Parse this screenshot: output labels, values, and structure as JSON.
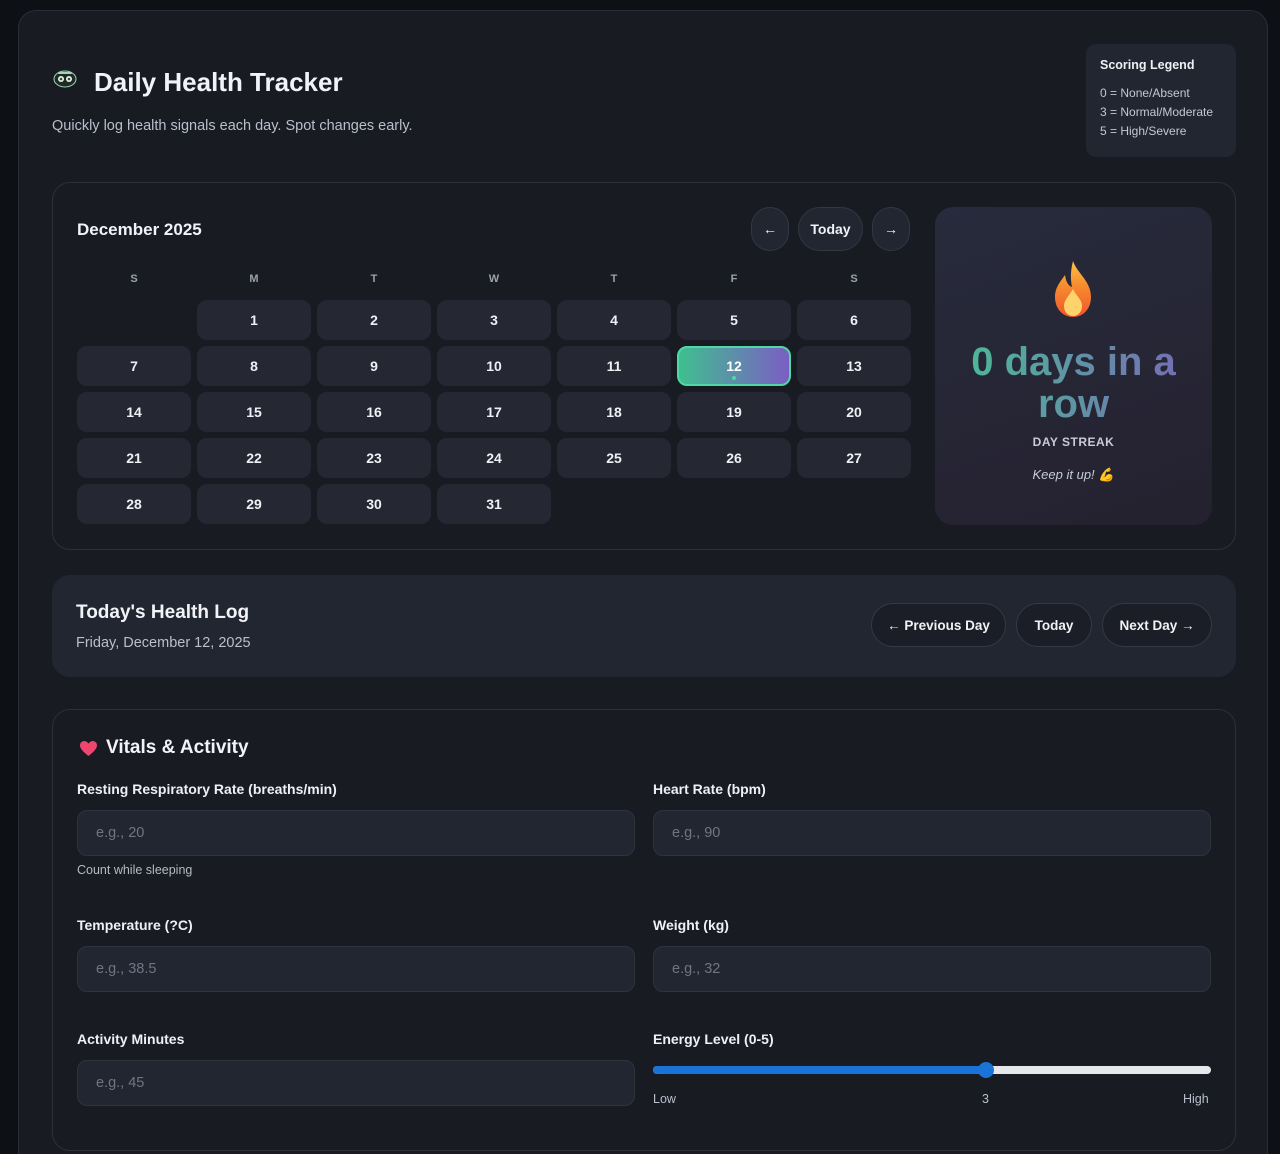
{
  "header": {
    "title": "Daily Health Tracker",
    "subtitle": "Quickly log health signals each day. Spot changes early."
  },
  "legend": {
    "title": "Scoring Legend",
    "rows": [
      "0 = None/Absent",
      "3 = Normal/Moderate",
      "5 = High/Severe"
    ]
  },
  "calendar": {
    "month_label": "December 2025",
    "prev_label": "←",
    "today_label": "Today",
    "next_label": "→",
    "weekdays": [
      "S",
      "M",
      "T",
      "W",
      "T",
      "F",
      "S"
    ],
    "leading_blanks": 1,
    "days": [
      "1",
      "2",
      "3",
      "4",
      "5",
      "6",
      "7",
      "8",
      "9",
      "10",
      "11",
      "12",
      "13",
      "14",
      "15",
      "16",
      "17",
      "18",
      "19",
      "20",
      "21",
      "22",
      "23",
      "24",
      "25",
      "26",
      "27",
      "28",
      "29",
      "30",
      "31"
    ],
    "selected_day": "12"
  },
  "streak": {
    "value_text": "0 days in a row",
    "label": "DAY STREAK",
    "message": "Keep it up! 💪"
  },
  "log": {
    "title": "Today's Health Log",
    "date": "Friday, December 12, 2025",
    "prev_day_label": "← Previous Day",
    "today_label": "Today",
    "next_day_label": "Next Day →"
  },
  "vitals": {
    "section_title": "Vitals & Activity",
    "respiratory": {
      "label": "Resting Respiratory Rate (breaths/min)",
      "placeholder": "e.g., 20",
      "value": "",
      "hint": "Count while sleeping"
    },
    "heart_rate": {
      "label": "Heart Rate (bpm)",
      "placeholder": "e.g., 90",
      "value": ""
    },
    "temperature": {
      "label": "Temperature (?C)",
      "placeholder": "e.g., 38.5",
      "value": ""
    },
    "weight": {
      "label": "Weight (kg)",
      "placeholder": "e.g., 32",
      "value": ""
    },
    "activity": {
      "label": "Activity Minutes",
      "placeholder": "e.g., 45",
      "value": ""
    },
    "energy": {
      "label": "Energy Level (0-5)",
      "value": 3,
      "min": 0,
      "max": 5,
      "value_text": "3",
      "low_label": "Low",
      "high_label": "High"
    }
  },
  "colors": {
    "accent_green": "#46c392",
    "accent_purple": "#7a64b8",
    "slider_blue": "#1a73d6",
    "background": "#181b22"
  }
}
